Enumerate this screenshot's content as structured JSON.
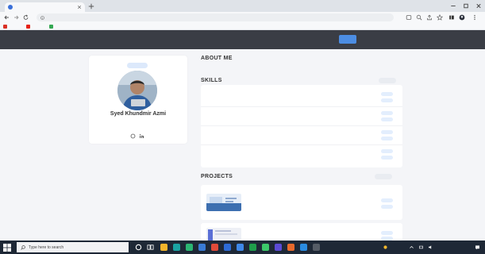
{
  "browser": {
    "tab_title": "",
    "url": "",
    "bookmarks": [
      {
        "label": "",
        "color": "#d93025"
      },
      {
        "label": "",
        "color": "#e62117"
      },
      {
        "label": "",
        "color": "#34a853"
      }
    ]
  },
  "navbar": {
    "brand": "",
    "links": [
      "",
      "",
      "",
      ""
    ],
    "cta_label": "",
    "accent": "#4c8de3"
  },
  "profile": {
    "badge": "",
    "name": "Syed Khundmir Azmi",
    "role": "",
    "social_icons": [
      "github-icon",
      "linkedin-icon"
    ]
  },
  "about": {
    "title": "ABOUT ME",
    "text": ""
  },
  "skills": {
    "title": "SKILLS",
    "add_label": "",
    "items": [
      {
        "name": "",
        "edit": "",
        "delete": ""
      },
      {
        "name": "",
        "edit": "",
        "delete": ""
      },
      {
        "name": "",
        "edit": "",
        "delete": ""
      },
      {
        "name": "",
        "edit": "",
        "delete": ""
      }
    ]
  },
  "projects": {
    "title": "PROJECTS",
    "add_label": "",
    "items": [
      {
        "title": "",
        "description": "",
        "edit": "",
        "delete": ""
      },
      {
        "title": "",
        "description": "",
        "edit": "",
        "delete": ""
      }
    ]
  },
  "taskbar": {
    "search_placeholder": "Type here to search",
    "weather": "",
    "time": "",
    "date": ""
  }
}
